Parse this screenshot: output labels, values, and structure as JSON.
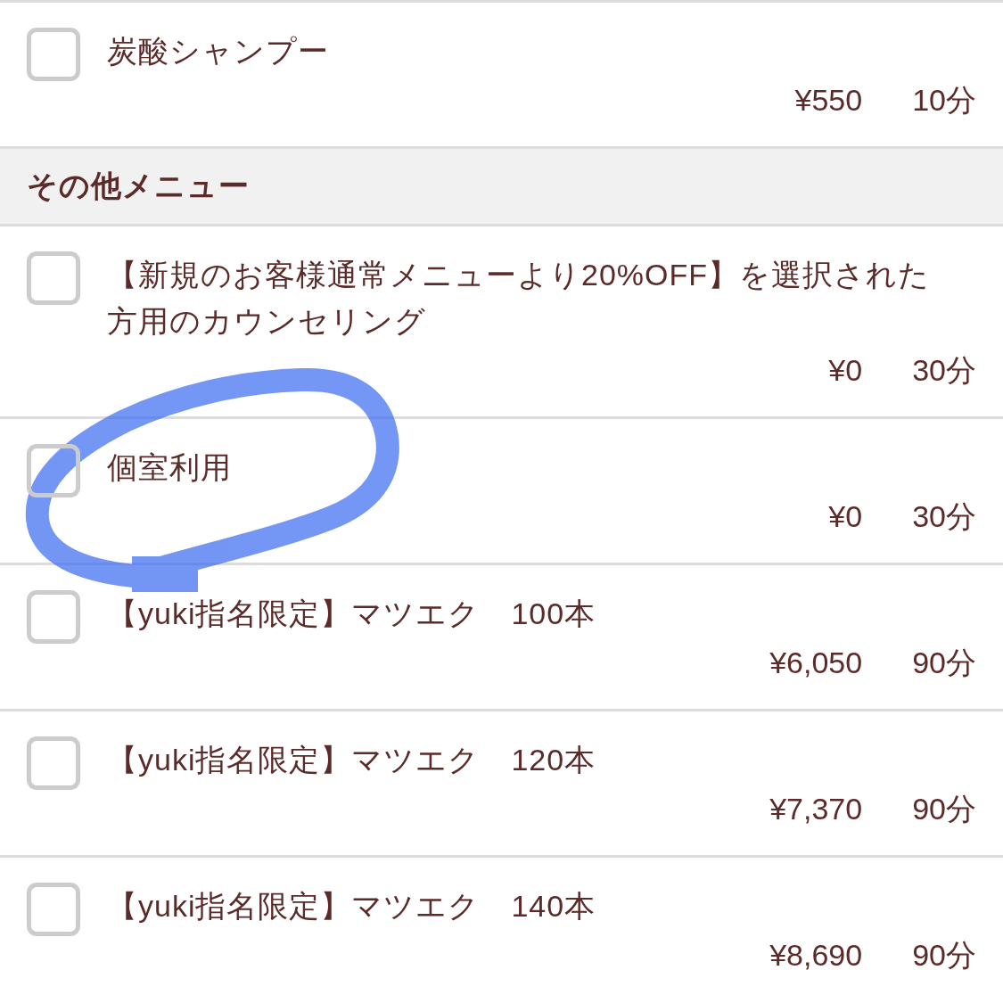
{
  "groups": [
    {
      "items": [
        {
          "title": "炭酸シャンプー",
          "price": "¥550",
          "duration": "10分",
          "checked": false,
          "highlighted": false
        }
      ]
    },
    {
      "header": "その他メニュー",
      "items": [
        {
          "title": "【新規のお客様通常メニューより20%OFF】を選択された方用のカウンセリング",
          "price": "¥0",
          "duration": "30分",
          "checked": false,
          "highlighted": false
        },
        {
          "title": "個室利用",
          "price": "¥0",
          "duration": "30分",
          "checked": false,
          "highlighted": true
        },
        {
          "title": "【yuki指名限定】マツエク　100本",
          "price": "¥6,050",
          "duration": "90分",
          "checked": false,
          "highlighted": false
        },
        {
          "title": "【yuki指名限定】マツエク　120本",
          "price": "¥7,370",
          "duration": "90分",
          "checked": false,
          "highlighted": false
        },
        {
          "title": "【yuki指名限定】マツエク　140本",
          "price": "¥8,690",
          "duration": "90分",
          "checked": false,
          "highlighted": false
        }
      ]
    }
  ]
}
